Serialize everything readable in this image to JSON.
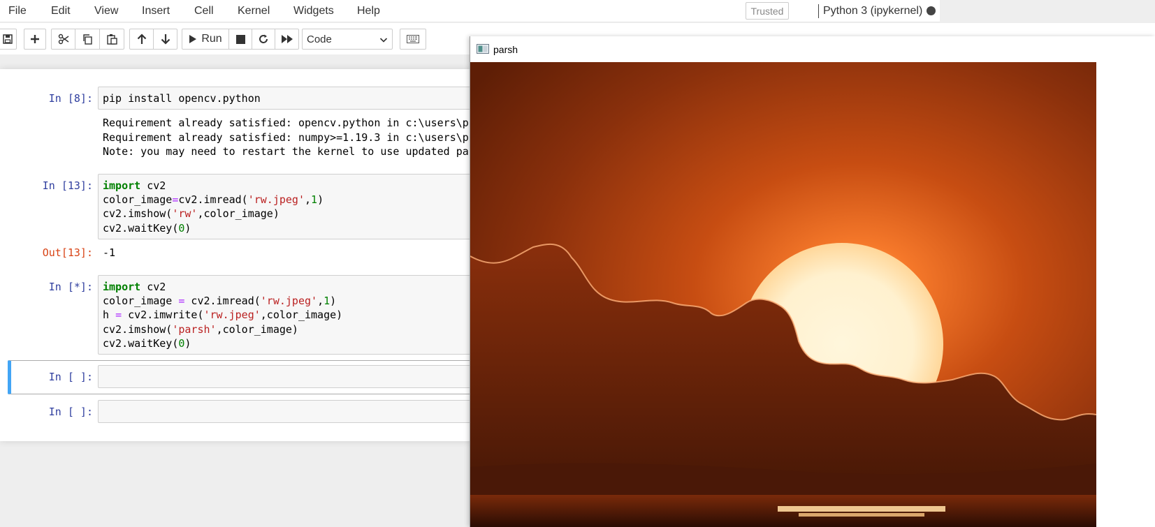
{
  "menu": [
    "File",
    "Edit",
    "View",
    "Insert",
    "Cell",
    "Kernel",
    "Widgets",
    "Help"
  ],
  "trusted_label": "Trusted",
  "kernel": "Python 3 (ipykernel)",
  "toolbar": {
    "run_label": "Run",
    "cell_type": "Code",
    "icons": [
      "save-icon",
      "plus-icon",
      "cut-icon",
      "copy-icon",
      "paste-icon",
      "arrow-up-icon",
      "arrow-down-icon",
      "run-icon",
      "stop-icon",
      "restart-icon",
      "fast-forward-icon",
      "keyboard-icon"
    ]
  },
  "cells": {
    "c1": {
      "prompt": "In [8]:",
      "code": "pip install opencv.python",
      "output": [
        "Requirement already satisfied: opencv.python in c:\\users\\p",
        "Requirement already satisfied: numpy>=1.19.3 in c:\\users\\p",
        "Note: you may need to restart the kernel to use updated pa"
      ]
    },
    "c2": {
      "prompt": "In [13]:",
      "out_prompt": "Out[13]:",
      "result": "-1"
    },
    "c3": {
      "prompt": "In [*]:"
    },
    "c4": {
      "prompt": "In [ ]:"
    },
    "c5": {
      "prompt": "In [ ]:"
    }
  },
  "window": {
    "title": "parsh"
  },
  "colors": {
    "prompt_in": "#303f9f",
    "prompt_out": "#d84315",
    "selected_border": "#42a5f5",
    "sky_top": "#6e2408",
    "sun": "#fff3d6"
  }
}
